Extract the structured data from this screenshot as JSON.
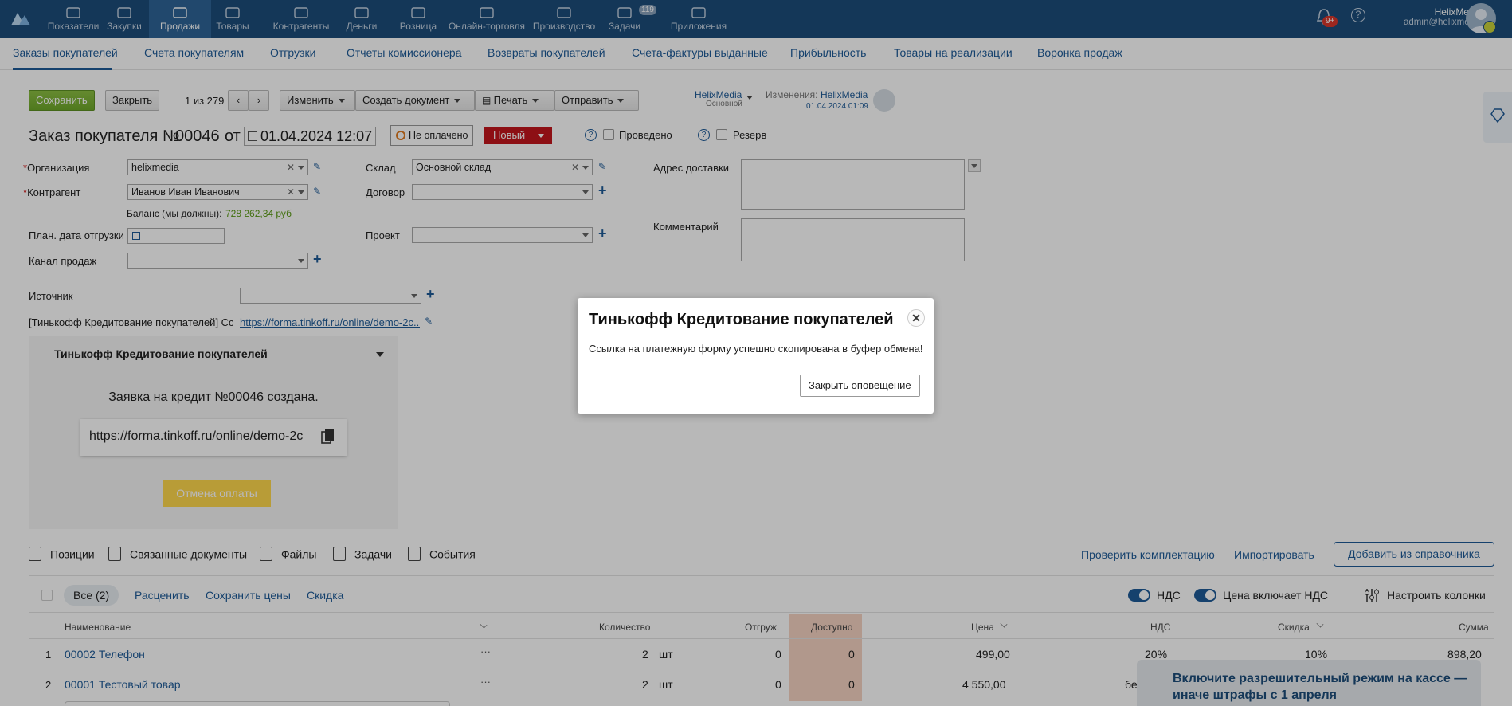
{
  "nav": {
    "items": [
      {
        "label": "Показатели",
        "icon": "chart-line-icon"
      },
      {
        "label": "Закупки",
        "icon": "purchase-icon"
      },
      {
        "label": "Продажи",
        "icon": "bag-icon",
        "active": true
      },
      {
        "label": "Товары",
        "icon": "cart-icon"
      },
      {
        "label": "Контрагенты",
        "icon": "people-icon"
      },
      {
        "label": "Деньги",
        "icon": "money-icon"
      },
      {
        "label": "Розница",
        "icon": "store-icon"
      },
      {
        "label": "Онлайн-торговля",
        "icon": "online-store-icon"
      },
      {
        "label": "Производство",
        "icon": "production-icon"
      },
      {
        "label": "Задачи",
        "icon": "tasks-icon",
        "badge": "119"
      },
      {
        "label": "Приложения",
        "icon": "apps-icon"
      }
    ],
    "notif_badge": "9+",
    "user_name": "HelixMedia",
    "user_email": "admin@helixmedia"
  },
  "subnav": {
    "tabs": [
      "Заказы покупателей",
      "Счета покупателям",
      "Отгрузки",
      "Отчеты комиссионера",
      "Возвраты покупателей",
      "Счета-фактуры выданные",
      "Прибыльность",
      "Товары на реализации",
      "Воронка продаж"
    ]
  },
  "toolbar": {
    "save": "Сохранить",
    "close": "Закрыть",
    "pager": "1 из 279",
    "change": "Изменить",
    "create_doc": "Создать документ",
    "print": "Печать",
    "send": "Отправить",
    "owner": "HelixMedia",
    "owner_sub": "Основной",
    "changes_label": "Изменения:",
    "changes_user": "HelixMedia",
    "changes_date": "01.04.2024 01:09"
  },
  "doc": {
    "title": "Заказ покупателя №",
    "number": "00046",
    "from": "от",
    "date": "01.04.2024 12:07",
    "pay_status": "Не оплачено",
    "state": "Новый",
    "posted": "Проведено",
    "reserve": "Резерв"
  },
  "form": {
    "org_label": "Организация",
    "org_value": "helixmedia",
    "counterparty_label": "Контрагент",
    "counterparty_value": "Иванов Иван Иванович",
    "balance_label": "Баланс (мы должны):",
    "balance_value": "728 262,34 руб",
    "ship_date_label": "План. дата отгрузки",
    "channel_label": "Канал продаж",
    "warehouse_label": "Склад",
    "warehouse_value": "Основной склад",
    "contract_label": "Договор",
    "project_label": "Проект",
    "address_label": "Адрес доставки",
    "comment_label": "Комментарий",
    "source_label": "Источник",
    "tinkoff_label": "[Тинькофф Кредитование покупателей] Сс...",
    "tinkoff_link": "https://forma.tinkoff.ru/online/demo-2c..."
  },
  "widget": {
    "title": "Тинькофф Кредитование покупателей",
    "status": "Заявка на кредит №00046 создана.",
    "link": "https://forma.tinkoff.ru/online/demo-2c",
    "cancel": "Отмена оплаты"
  },
  "tabs": {
    "items": [
      "Позиции",
      "Связанные документы",
      "Файлы",
      "Задачи",
      "События"
    ],
    "check": "Проверить комплектацию",
    "import": "Импортировать",
    "add": "Добавить из справочника"
  },
  "filters": {
    "all": "Все (2)",
    "reprice": "Расценить",
    "save_prices": "Сохранить цены",
    "discount": "Скидка",
    "vat": "НДС",
    "price_incl_vat": "Цена включает НДС",
    "columns": "Настроить колонки"
  },
  "table": {
    "headers": {
      "name": "Наименование",
      "qty": "Количество",
      "shipped": "Отгруж.",
      "available": "Доступно",
      "price": "Цена",
      "vat": "НДС",
      "discount": "Скидка",
      "sum": "Сумма"
    },
    "rows": [
      {
        "n": "1",
        "name": "00002 Телефон",
        "qty": "2",
        "unit": "шт",
        "shipped": "0",
        "available": "0",
        "price": "499,00",
        "vat": "20%",
        "discount": "10%",
        "sum": "898,20"
      },
      {
        "n": "2",
        "name": "00001 Тестовый товар",
        "qty": "2",
        "unit": "шт",
        "shipped": "0",
        "available": "0",
        "price": "4 550,00",
        "vat": "бе",
        "discount": "",
        "sum": ""
      }
    ]
  },
  "promo": "Включите разрешительный режим на кассе — иначе штрафы с 1 апреля",
  "modal": {
    "title": "Тинькофф Кредитование покупателей",
    "message": "Ссылка на платежную форму успешно скопирована в буфер обмена!",
    "button": "Закрыть оповещение"
  }
}
